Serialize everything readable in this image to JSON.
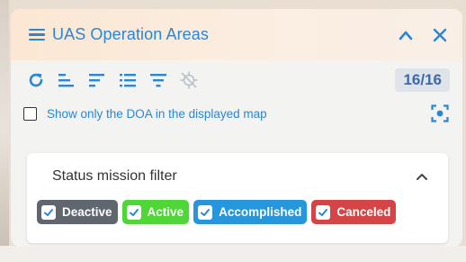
{
  "window": {
    "title": "UAS Operation Areas"
  },
  "toolbar": {
    "counter": "16/16"
  },
  "map_filter": {
    "label": "Show only the DOA in the displayed map",
    "checked": false
  },
  "status_filter": {
    "title": "Status mission filter",
    "chips": [
      {
        "label": "Deactive",
        "color": "#5f6670",
        "checked": true
      },
      {
        "label": "Active",
        "color": "#4fd637",
        "checked": true
      },
      {
        "label": "Accomplished",
        "color": "#2697dc",
        "checked": true
      },
      {
        "label": "Canceled",
        "color": "#d64545",
        "checked": true
      }
    ]
  },
  "icons": {
    "menu": "hamburger-menu-icon",
    "collapse": "chevron-up-icon",
    "close": "close-icon",
    "refresh": "refresh-icon",
    "sort_a": "sort-align-left-icon",
    "sort_b": "sort-descending-icon",
    "list": "list-icon",
    "filter": "filter-icon",
    "location_off": "location-off-icon",
    "focus": "center-focus-icon"
  },
  "colors": {
    "accent": "#2a86d6",
    "header_bg": "#fbe7d3",
    "counter_bg": "#dfe3ea"
  }
}
